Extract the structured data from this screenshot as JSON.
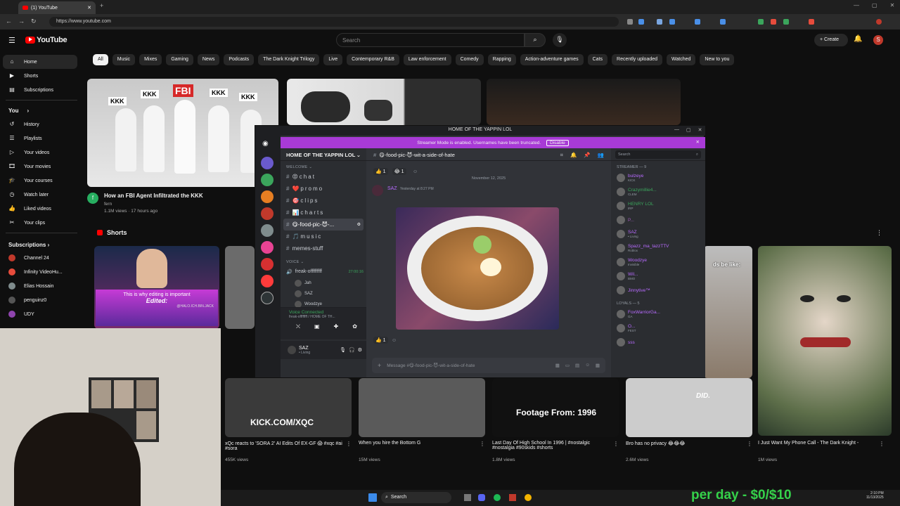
{
  "browser": {
    "tab_title": "(1) YouTube",
    "url": "https://www.youtube.com"
  },
  "youtube": {
    "logo": "YouTube",
    "search_placeholder": "Search",
    "create_label": "Create",
    "avatar_letter": "S",
    "chips": [
      "All",
      "Music",
      "Mixes",
      "Gaming",
      "News",
      "Podcasts",
      "The Dark Knight Trilogy",
      "Live",
      "Contemporary R&B",
      "Law enforcement",
      "Comedy",
      "Rapping",
      "Action-adventure games",
      "Cats",
      "Recently uploaded",
      "Watched",
      "New to you"
    ],
    "sidebar": {
      "main": [
        {
          "label": "Home",
          "icon": "home-icon"
        },
        {
          "label": "Shorts",
          "icon": "shorts-icon"
        },
        {
          "label": "Subscriptions",
          "icon": "subscriptions-icon"
        }
      ],
      "you_heading": "You",
      "you": [
        {
          "label": "History",
          "icon": "history-icon"
        },
        {
          "label": "Playlists",
          "icon": "playlists-icon"
        },
        {
          "label": "Your videos",
          "icon": "your-videos-icon"
        },
        {
          "label": "Your movies",
          "icon": "movies-icon"
        },
        {
          "label": "Your courses",
          "icon": "courses-icon"
        },
        {
          "label": "Watch later",
          "icon": "clock-icon"
        },
        {
          "label": "Liked videos",
          "icon": "like-icon"
        },
        {
          "label": "Your clips",
          "icon": "scissors-icon"
        }
      ],
      "subs_heading": "Subscriptions",
      "subs": [
        "Channel 24",
        "Infinity VideoHu...",
        "Elias Hossain",
        "penguinz0",
        "UDY"
      ]
    },
    "featured": {
      "title": "How an FBI Agent Infiltrated the KKK",
      "channel": "fern",
      "meta": "1.1M views · 17 hours ago",
      "thumb_labels": [
        "KKK",
        "KKK",
        "FBI",
        "KKK",
        "KKK"
      ]
    },
    "shorts_heading": "Shorts",
    "shorts": [
      {
        "title": "xQc reacts to 'SORA 2' AI Edits Of EX-GF 😱 #xqc #ai #sora",
        "views": "455K views",
        "overlay": "KICK.COM/XQC"
      },
      {
        "title": "When you hire the Bottom G",
        "views": "15M views",
        "overlay": ""
      },
      {
        "title": "Last Day Of High School In 1996 | #nostalgic #nostalgia #90skids #shorts",
        "views": "1.8M views",
        "overlay": "Footage From: 1996"
      },
      {
        "title": "Bro has no privacy 😂😂😂",
        "views": "2.6M views",
        "overlay": "DID."
      },
      {
        "title": "I Just Want My Phone Call - The Dark Knight -",
        "views": "1M views",
        "overlay": ""
      }
    ],
    "short_left_caption": "This is why editing is important",
    "short_left_edited": "Edited:",
    "short_left_handle": "@HALO.ICH.BIN.JACK",
    "short_right_caption": "ds be like:"
  },
  "discord": {
    "window_title": "HOME OF THE YAPPIN LOL",
    "banner": "Streamer Mode is enabled. Usernames have been truncated.",
    "banner_button": "Disable",
    "server_name": "HOME OF THE YAPPIN LOL",
    "current_channel": "😋-food-pic-😈-wit-a-side-of-hate",
    "search_placeholder": "Search",
    "welcome": "WELCOME",
    "channels": [
      "😡chat",
      "❤️promo",
      "🎯clips",
      "📊charts",
      "😋-food-pic-😈-...",
      "🎵music",
      "memes-stuff"
    ],
    "voice_heading": "VOICE",
    "voice_channel": "freak-offfffffff",
    "voice_timer": "27:00:16",
    "voice_users": [
      "Jah",
      "SAZ",
      "Woodzye"
    ],
    "voice_status": "Voice Connected",
    "voice_sub": "freak-offffffff / HOME OF TH...",
    "user_name": "SAZ",
    "user_status": "• Living",
    "message_date": "November 12, 2025",
    "message_author": "SAZ",
    "message_time": "Yesterday at 8:27 PM",
    "reactions_top": [
      "👍 1",
      "😂 1"
    ],
    "reactions_bottom": [
      "👍 1"
    ],
    "message_placeholder": "Message #😋-food-pic-😈-wit-a-side-of-hate",
    "streamer_heading": "STREAMER — 9",
    "streamers": [
      {
        "name": "bulzeye",
        "tag": "KICK",
        "color": "#b86bff"
      },
      {
        "name": "Crazymillie4...",
        "tag": "CLEM",
        "color": "#3ba55c"
      },
      {
        "name": "HENRY LOL",
        "tag": "IRP",
        "color": "#3ba55c"
      },
      {
        "name": "P...",
        "tag": "",
        "color": "#9b59b6"
      },
      {
        "name": "SAZ",
        "tag": "• Living",
        "color": "#b86bff"
      },
      {
        "name": "Spazz_ma_tazzTTV",
        "tag": "Roblox",
        "color": "#b86bff"
      },
      {
        "name": "Woodzye",
        "tag": "Invisible",
        "color": "#b86bff"
      },
      {
        "name": "Wil...",
        "tag": "BMO",
        "color": "#b86bff"
      },
      {
        "name": "Jinnytive™",
        "tag": "",
        "color": "#b86bff"
      }
    ],
    "loyals_heading": "LOYALS — 5",
    "loyals": [
      {
        "name": "FoxWarriorGa...",
        "tag": "GA",
        "color": "#b86bff"
      },
      {
        "name": "O...",
        "tag": "FEST",
        "color": "#b86bff"
      },
      {
        "name": "sss",
        "tag": "",
        "color": "#b86bff"
      }
    ]
  },
  "taskbar": {
    "search": "Search",
    "time": "2:10 PM",
    "date": "11/13/2025"
  },
  "overlay_text": "per day - $0/$10",
  "colors": {
    "yt_red": "#ff0000",
    "discord_purple": "#a83ad6",
    "overlay_green": "#35d14a"
  }
}
